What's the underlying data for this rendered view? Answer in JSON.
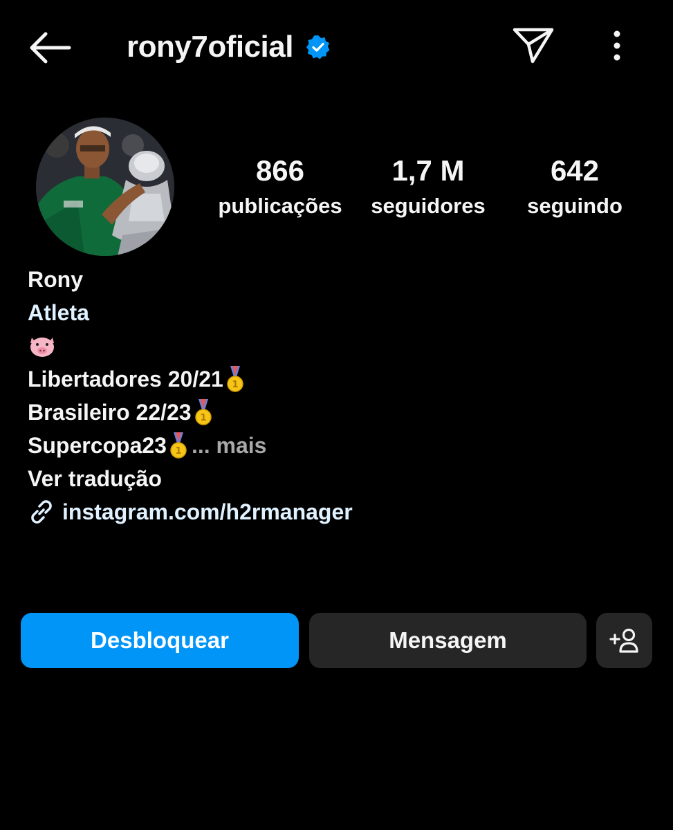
{
  "header": {
    "username": "rony7oficial",
    "back_icon": "arrow-left-icon",
    "verified_icon": "verified-badge-icon",
    "send_icon": "paper-plane-icon",
    "more_icon": "more-vertical-icon"
  },
  "profile": {
    "avatar_icon": "profile-avatar",
    "stats": [
      {
        "value": "866",
        "label": "publicações"
      },
      {
        "value": "1,7 M",
        "label": "seguidores"
      },
      {
        "value": "642",
        "label": "seguindo"
      }
    ]
  },
  "bio": {
    "name": "Rony",
    "category": "Atleta",
    "emoji_line": "🐷",
    "lines": [
      "Libertadores 20/21",
      "Brasileiro 22/23",
      "Supercopa23"
    ],
    "more_label": "... mais",
    "translate_label": "Ver tradução",
    "link": "instagram.com/h2rmanager",
    "link_icon": "link-icon",
    "medal_icon": "medal-icon"
  },
  "actions": {
    "unblock_label": "Desbloquear",
    "message_label": "Mensagem",
    "add_icon": "add-person-icon"
  },
  "colors": {
    "background": "#000000",
    "text": "#f5f5f5",
    "accent_blue": "#0095f6",
    "verified_blue": "#0095f6",
    "secondary_button": "#262626",
    "muted": "#a8a8a8",
    "link": "#e0f1ff"
  }
}
